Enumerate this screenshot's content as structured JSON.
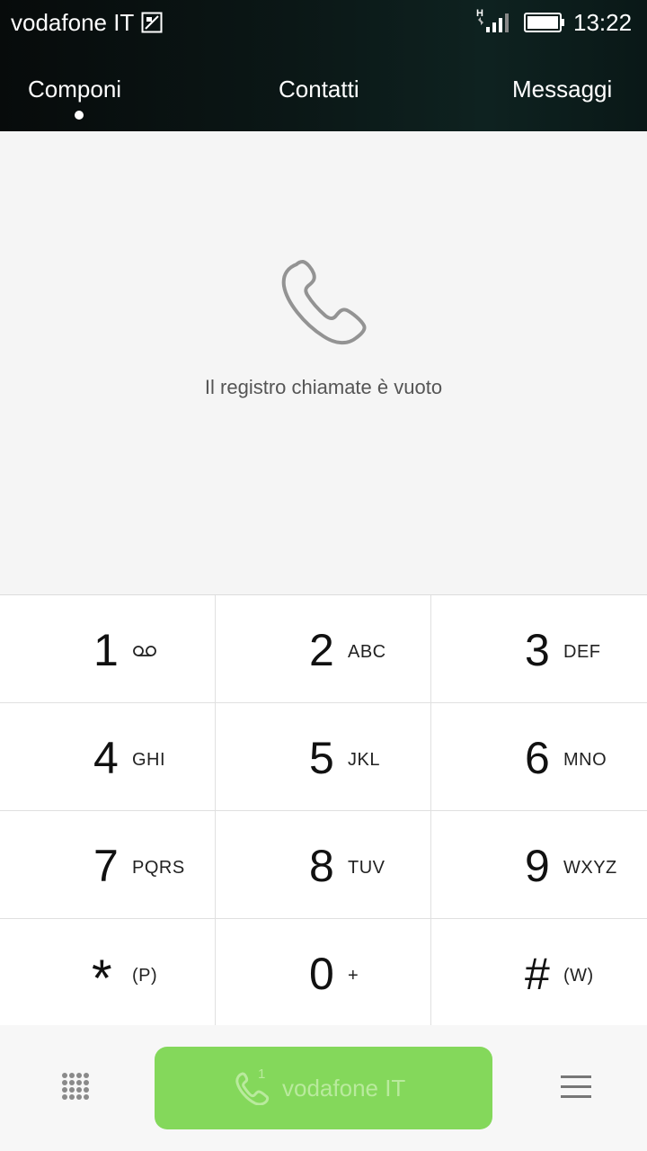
{
  "status_bar": {
    "carrier": "vodafone IT",
    "network_type": "H",
    "time": "13:22",
    "icons": [
      "sim-card-icon",
      "signal-icon",
      "battery-icon"
    ]
  },
  "tabs": [
    {
      "label": "Componi",
      "active": true
    },
    {
      "label": "Contatti",
      "active": false
    },
    {
      "label": "Messaggi",
      "active": false
    }
  ],
  "call_log": {
    "empty_message": "Il registro chiamate è vuoto",
    "icon": "phone-icon"
  },
  "keypad": {
    "keys": [
      {
        "digit": "1",
        "letters": "",
        "icon": "voicemail-icon"
      },
      {
        "digit": "2",
        "letters": "ABC"
      },
      {
        "digit": "3",
        "letters": "DEF"
      },
      {
        "digit": "4",
        "letters": "GHI"
      },
      {
        "digit": "5",
        "letters": "JKL"
      },
      {
        "digit": "6",
        "letters": "MNO"
      },
      {
        "digit": "7",
        "letters": "PQRS"
      },
      {
        "digit": "8",
        "letters": "TUV"
      },
      {
        "digit": "9",
        "letters": "WXYZ"
      },
      {
        "digit": "*",
        "letters": "(P)"
      },
      {
        "digit": "0",
        "letters": "+"
      },
      {
        "digit": "#",
        "letters": "(W)"
      }
    ]
  },
  "bottom_bar": {
    "call_button_label": "vodafone IT",
    "sim_number": "1",
    "call_button_color": "#84d85b",
    "icons": [
      "dialpad-icon",
      "menu-icon"
    ]
  }
}
